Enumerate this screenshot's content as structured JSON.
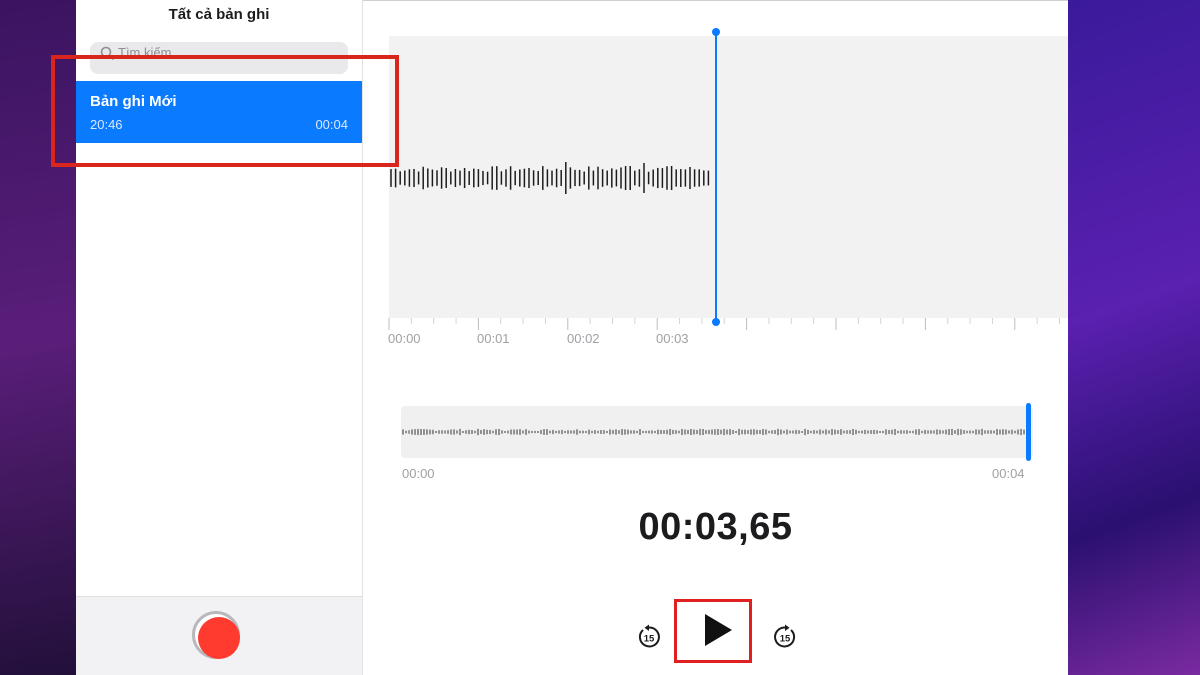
{
  "sidebar": {
    "title": "Tất cả bản ghi",
    "search_placeholder": "Tìm kiếm",
    "recordings": [
      {
        "name": "Bản ghi Mới",
        "time": "20:46",
        "duration": "00:04",
        "selected": true
      }
    ],
    "record_icon": "record-icon"
  },
  "editor": {
    "timeline_labels": [
      "00:00",
      "00:01",
      "00:02",
      "00:03"
    ],
    "overview_start": "00:00",
    "overview_end": "00:04",
    "current_time": "00:03,65",
    "playhead_position_seconds": 3.65,
    "overview_progress": 1.0
  },
  "controls": {
    "skip_back_icon": "skip-back-15-icon",
    "skip_back_label": "15",
    "play_icon": "play-icon",
    "skip_forward_icon": "skip-forward-15-icon",
    "skip_forward_label": "15"
  },
  "colors": {
    "accent": "#0a7aff",
    "record": "#ff3b30",
    "highlight": "#d9261c"
  }
}
